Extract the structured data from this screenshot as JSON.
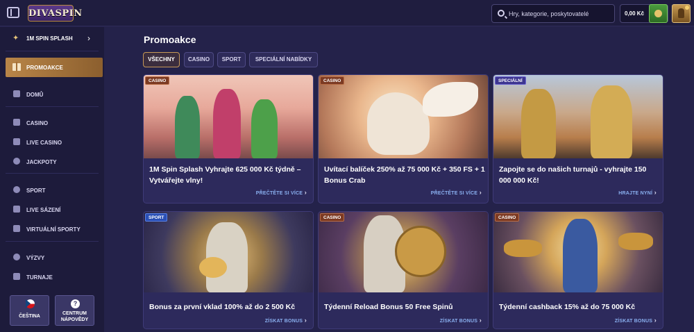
{
  "header": {
    "logo": "DIVASPIN",
    "search_placeholder": "Hry, kategorie, poskytovatelé",
    "balance": "0,00 Kč"
  },
  "sidebar": {
    "featured": "1M SPIN SPLASH",
    "active": "PROMOAKCE",
    "items": [
      {
        "label": "DOMŮ",
        "icon": "home-icon"
      },
      {
        "label": "CASINO",
        "icon": "slot-machine-icon"
      },
      {
        "label": "LIVE CASINO",
        "icon": "cards-icon"
      },
      {
        "label": "JACKPOTY",
        "icon": "jackpot-icon"
      },
      {
        "label": "SPORT",
        "icon": "ball-icon"
      },
      {
        "label": "LIVE SÁZENÍ",
        "icon": "live-icon"
      },
      {
        "label": "VIRTUÁLNÍ SPORTY",
        "icon": "virtual-icon"
      },
      {
        "label": "VÝZVY",
        "icon": "challenge-icon"
      },
      {
        "label": "TURNAJE",
        "icon": "trophy-icon"
      }
    ],
    "language_label": "ČEŠTINA",
    "help_label_line1": "CENTRUM",
    "help_label_line2": "NÁPOVĚDY",
    "help_icon": "?"
  },
  "main": {
    "title": "Promoakce",
    "filters": [
      "VŠECHNY",
      "CASINO",
      "SPORT",
      "SPECIÁLNÍ NABÍDKY"
    ],
    "cards": [
      {
        "tag": "CASINO",
        "title": "1M Spin Splash Vyhrajte 625 000 Kč týdně – Vytvářejte vlny!",
        "cta": "PŘEČTĚTE SI VÍCE"
      },
      {
        "tag": "CASINO",
        "title": "Uvítací balíček 250% až 75 000 Kč + 350 FS + 1 Bonus Crab",
        "cta": "PŘEČTĚTE SI VÍCE"
      },
      {
        "tag": "SPECIÁLNÍ",
        "title": "Zapojte se do našich turnajů - vyhrajte 150 000 000 Kč!",
        "cta": "HRAJTE NYNÍ"
      },
      {
        "tag": "SPORT",
        "title": "Bonus za první vklad 100% až do 2 500 Kč",
        "cta": "ZÍSKAT BONUS"
      },
      {
        "tag": "CASINO",
        "title": "Týdenní Reload Bonus 50 Free Spinů",
        "cta": "ZÍSKAT BONUS"
      },
      {
        "tag": "CASINO",
        "title": "Týdenní cashback 15% až do 75 000 Kč",
        "cta": "ZÍSKAT BONUS"
      }
    ]
  },
  "colors": {
    "background": "#24224a",
    "sidebar": "#1d1b3b",
    "accent_gold": "#b88548",
    "card_bg": "#2d2a5c",
    "link_blue": "#8ab0f0"
  }
}
